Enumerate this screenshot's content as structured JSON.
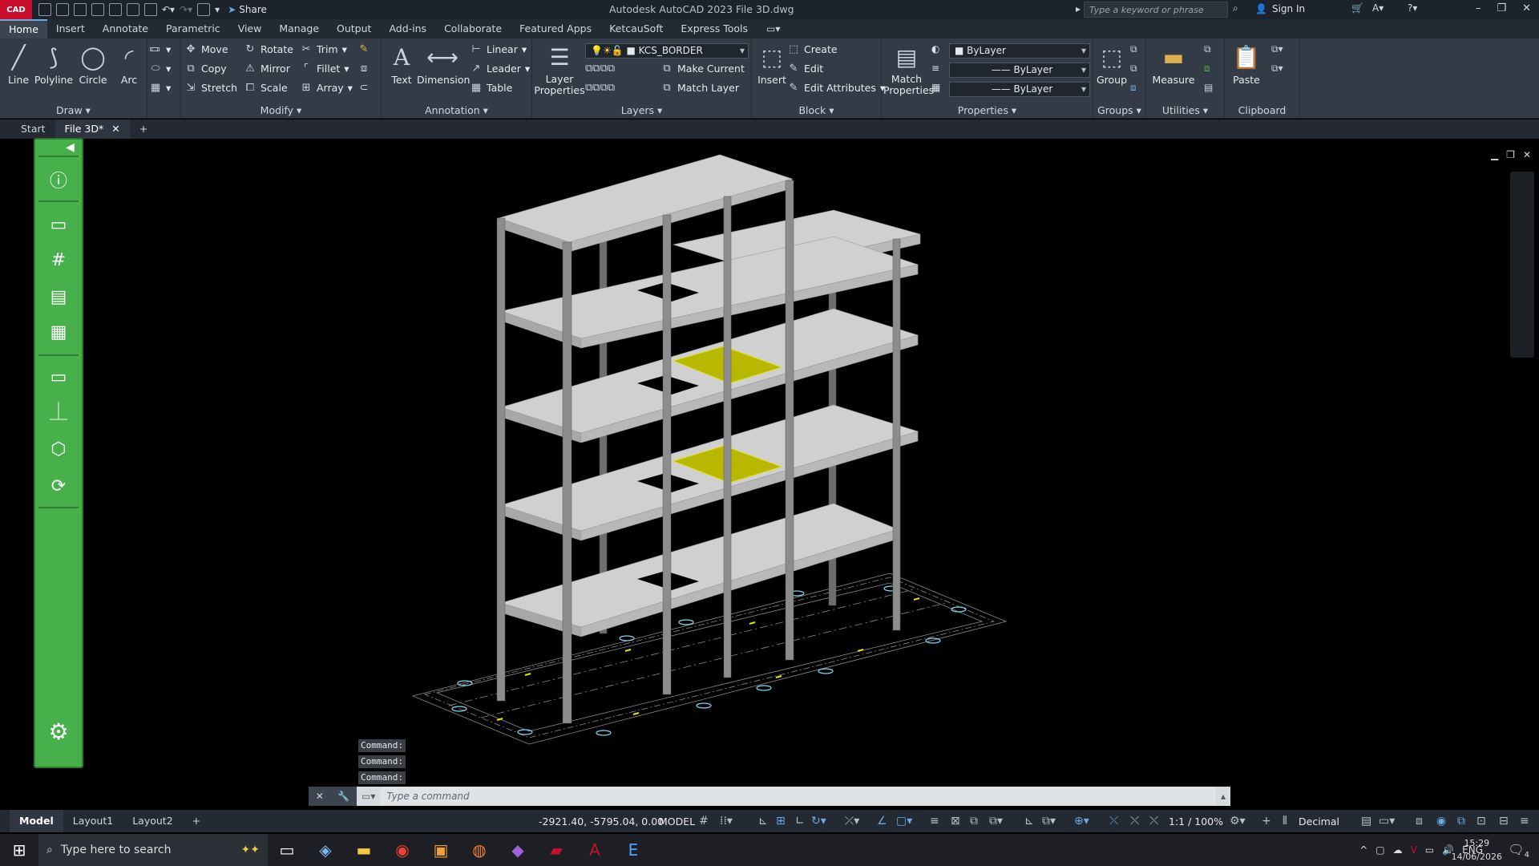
{
  "titlebar": {
    "app_logo": "CAD",
    "share_label": "Share",
    "title": "Autodesk AutoCAD 2023    File 3D.dwg",
    "search_placeholder": "Type a keyword or phrase",
    "signin_label": "Sign In"
  },
  "menu_tabs": [
    "Home",
    "Insert",
    "Annotate",
    "Parametric",
    "View",
    "Manage",
    "Output",
    "Add-ins",
    "Collaborate",
    "Featured Apps",
    "KetcauSoft",
    "Express Tools"
  ],
  "ribbon": {
    "draw": {
      "title": "Draw",
      "line": "Line",
      "polyline": "Polyline",
      "circle": "Circle",
      "arc": "Arc"
    },
    "modify": {
      "title": "Modify",
      "move": "Move",
      "rotate": "Rotate",
      "trim": "Trim",
      "copy": "Copy",
      "mirror": "Mirror",
      "fillet": "Fillet",
      "stretch": "Stretch",
      "scale": "Scale",
      "array": "Array"
    },
    "annotation": {
      "title": "Annotation",
      "text": "Text",
      "dimension": "Dimension",
      "linear": "Linear",
      "leader": "Leader",
      "table": "Table"
    },
    "layers": {
      "title": "Layers",
      "layer_properties": "Layer Properties",
      "current_layer": "KCS_BORDER",
      "make_current": "Make Current",
      "match_layer": "Match Layer"
    },
    "block": {
      "title": "Block",
      "insert": "Insert",
      "create": "Create",
      "edit": "Edit",
      "edit_attributes": "Edit Attributes"
    },
    "properties": {
      "title": "Properties",
      "match_properties": "Match Properties",
      "color": "ByLayer",
      "linetype": "ByLayer",
      "lineweight": "ByLayer"
    },
    "groups": {
      "title": "Groups",
      "group": "Group"
    },
    "utilities": {
      "title": "Utilities",
      "measure": "Measure"
    },
    "clipboard": {
      "title": "Clipboard",
      "paste": "Paste"
    }
  },
  "doc_tabs": {
    "start": "Start",
    "file": "File 3D*"
  },
  "command_history": [
    "Command:",
    "Command:",
    "Command:"
  ],
  "command_placeholder": "Type a command",
  "status": {
    "layouts": [
      "Model",
      "Layout1",
      "Layout2"
    ],
    "coords": "-2921.40, -5795.04, 0.00",
    "model": "MODEL",
    "scale": "1:1 / 100%",
    "units": "Decimal"
  },
  "taskbar": {
    "search_placeholder": "Type here to search",
    "language": "ENG",
    "time": "15:29",
    "date": "14/06/2026",
    "notification_count": "4"
  },
  "colors": {
    "palette_green": "#48b04a",
    "slab": "#cfcfcf",
    "highlight": "#c8c800",
    "accent": "#6fa8dc"
  }
}
